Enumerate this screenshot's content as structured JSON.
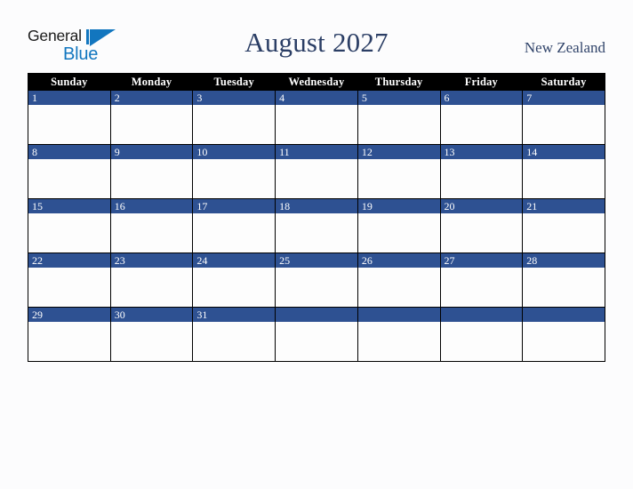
{
  "logo": {
    "word_general": "General",
    "word_blue": "Blue",
    "brand_black": "#1b1b1b",
    "brand_blue": "#1276bf"
  },
  "header": {
    "title": "August 2027",
    "country": "New Zealand",
    "title_color": "#2b3e65"
  },
  "calendar": {
    "accent_color": "#2e5192",
    "header_background": "#000000",
    "weekday_headers": [
      "Sunday",
      "Monday",
      "Tuesday",
      "Wednesday",
      "Thursday",
      "Friday",
      "Saturday"
    ],
    "weeks": [
      [
        {
          "day": "1"
        },
        {
          "day": "2"
        },
        {
          "day": "3"
        },
        {
          "day": "4"
        },
        {
          "day": "5"
        },
        {
          "day": "6"
        },
        {
          "day": "7"
        }
      ],
      [
        {
          "day": "8"
        },
        {
          "day": "9"
        },
        {
          "day": "10"
        },
        {
          "day": "11"
        },
        {
          "day": "12"
        },
        {
          "day": "13"
        },
        {
          "day": "14"
        }
      ],
      [
        {
          "day": "15"
        },
        {
          "day": "16"
        },
        {
          "day": "17"
        },
        {
          "day": "18"
        },
        {
          "day": "19"
        },
        {
          "day": "20"
        },
        {
          "day": "21"
        }
      ],
      [
        {
          "day": "22"
        },
        {
          "day": "23"
        },
        {
          "day": "24"
        },
        {
          "day": "25"
        },
        {
          "day": "26"
        },
        {
          "day": "27"
        },
        {
          "day": "28"
        }
      ],
      [
        {
          "day": "29"
        },
        {
          "day": "30"
        },
        {
          "day": "31"
        },
        {
          "day": ""
        },
        {
          "day": ""
        },
        {
          "day": ""
        },
        {
          "day": ""
        }
      ]
    ]
  }
}
